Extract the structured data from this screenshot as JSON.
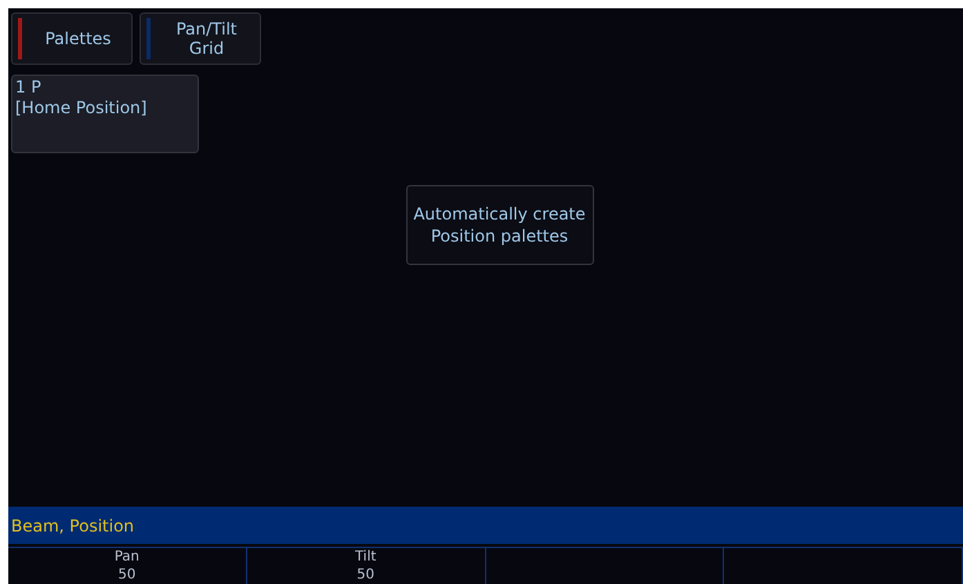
{
  "tabs": [
    {
      "label": "Palettes",
      "color": "#a01818"
    },
    {
      "label": "Pan/Tilt Grid",
      "color": "#0c2a66"
    }
  ],
  "palettes": [
    {
      "number": "1 P",
      "name": "[Home Position]"
    }
  ],
  "create_button": "Automatically create Position palettes",
  "category_bar": "Beam, Position",
  "encoders": [
    {
      "kind": "parameter",
      "name": "Pan",
      "value": "50"
    },
    {
      "kind": "parameter",
      "name": "Tilt",
      "value": "50"
    },
    {
      "kind": "blank"
    },
    {
      "kind": "blank"
    }
  ]
}
